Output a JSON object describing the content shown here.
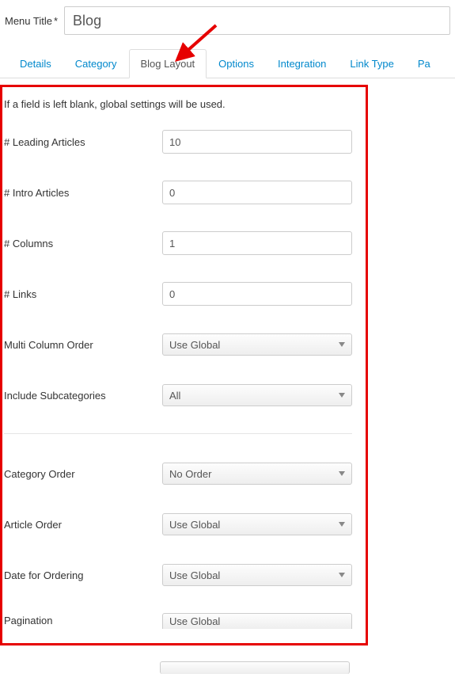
{
  "title": {
    "label": "Menu Title",
    "required_marker": "*",
    "value": "Blog"
  },
  "tabs": {
    "details": "Details",
    "category": "Category",
    "blog_layout": "Blog Layout",
    "options": "Options",
    "integration": "Integration",
    "link_type": "Link Type",
    "page_partial": "Pa"
  },
  "help_text": "If a field is left blank, global settings will be used.",
  "fields": {
    "leading_articles": {
      "label": "# Leading Articles",
      "value": "10"
    },
    "intro_articles": {
      "label": "# Intro Articles",
      "value": "0"
    },
    "columns": {
      "label": "# Columns",
      "value": "1"
    },
    "links": {
      "label": "# Links",
      "value": "0"
    },
    "multi_column_order": {
      "label": "Multi Column Order",
      "value": "Use Global"
    },
    "include_subcategories": {
      "label": "Include Subcategories",
      "value": "All"
    },
    "category_order": {
      "label": "Category Order",
      "value": "No Order"
    },
    "article_order": {
      "label": "Article Order",
      "value": "Use Global"
    },
    "date_for_ordering": {
      "label": "Date for Ordering",
      "value": "Use Global"
    },
    "pagination": {
      "label": "Pagination",
      "value": "Use Global"
    },
    "pagination_results": {
      "label": "",
      "value": ""
    }
  }
}
